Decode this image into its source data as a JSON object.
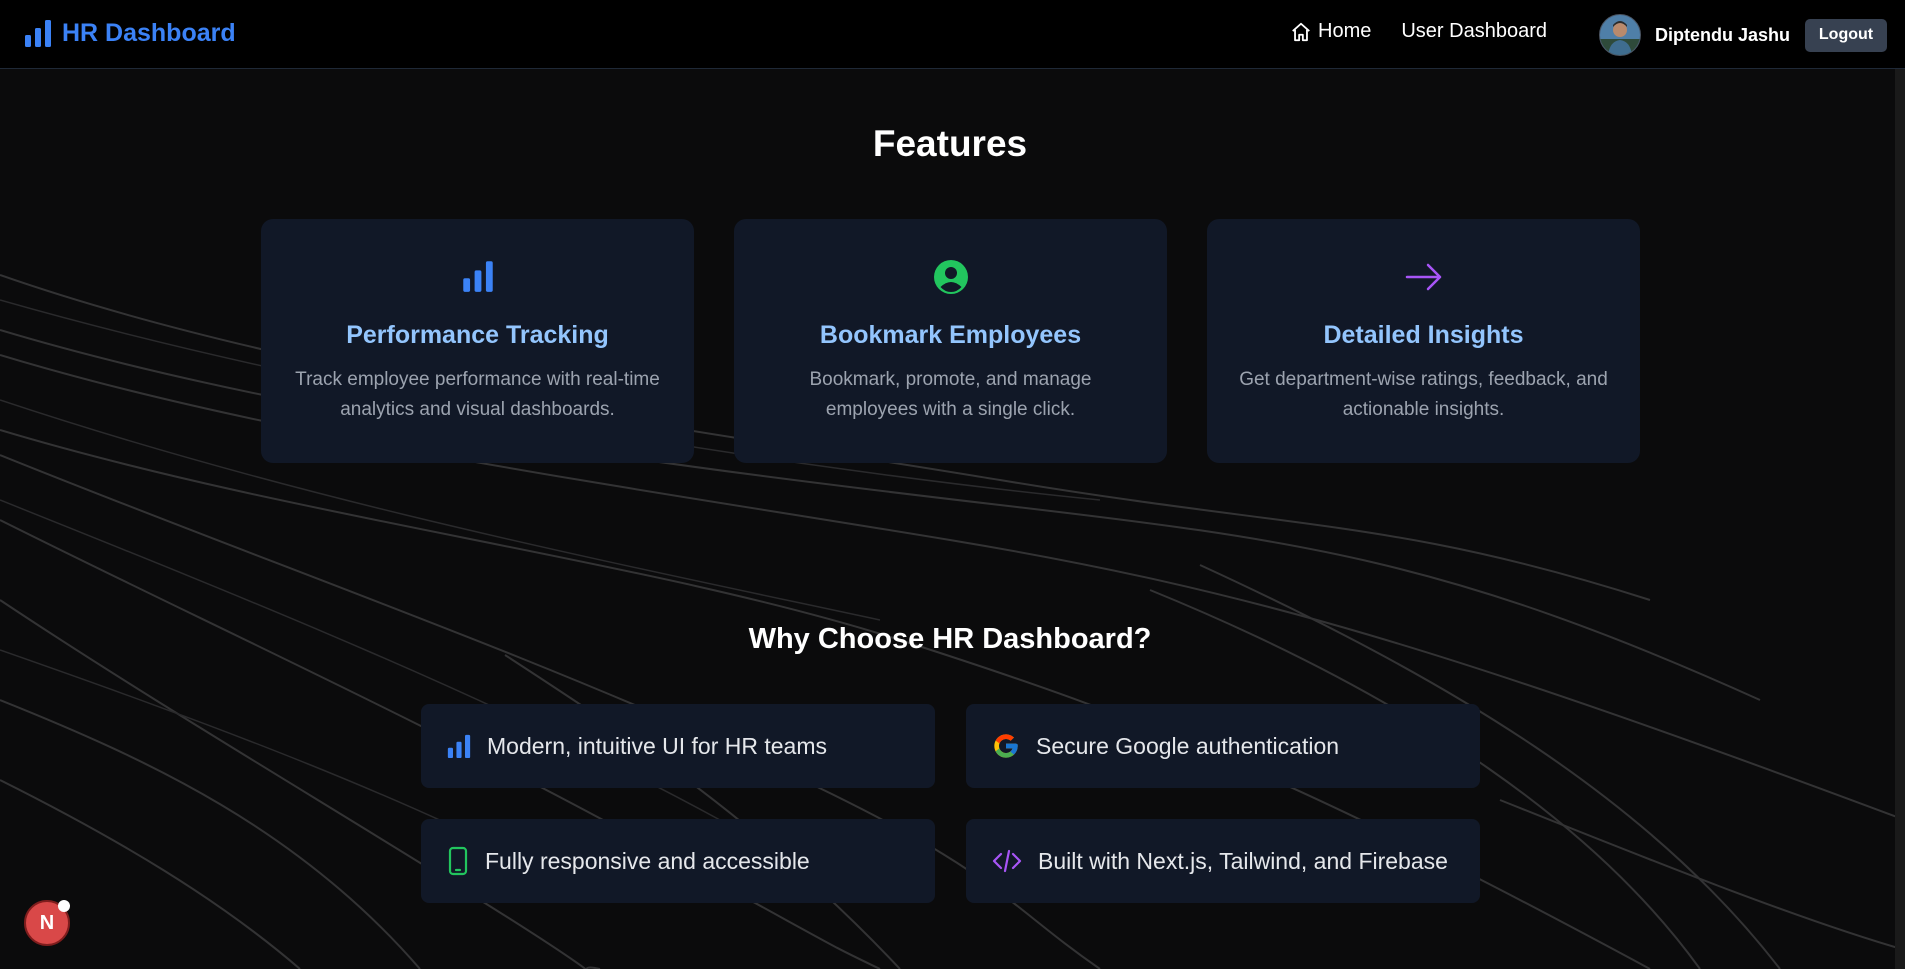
{
  "nav": {
    "brand": "HR Dashboard",
    "links": [
      {
        "label": "Home",
        "icon": "home-icon"
      },
      {
        "label": "User Dashboard"
      }
    ],
    "user_name": "Diptendu Jashu",
    "logout_label": "Logout"
  },
  "features": {
    "title": "Features",
    "cards": [
      {
        "icon": "bar-chart-icon",
        "icon_color": "#3b82f6",
        "title": "Performance Tracking",
        "description": "Track employee performance with real-time analytics and visual dashboards."
      },
      {
        "icon": "user-circle-icon",
        "icon_color": "#22c55e",
        "title": "Bookmark Employees",
        "description": "Bookmark, promote, and manage employees with a single click."
      },
      {
        "icon": "arrow-right-icon",
        "icon_color": "#a855f7",
        "title": "Detailed Insights",
        "description": "Get department-wise ratings, feedback, and actionable insights."
      }
    ]
  },
  "why": {
    "title": "Why Choose HR Dashboard?",
    "items": [
      {
        "icon": "bar-chart-icon",
        "text": "Modern, intuitive UI for HR teams"
      },
      {
        "icon": "google-icon",
        "text": "Secure Google authentication"
      },
      {
        "icon": "mobile-icon",
        "text": "Fully responsive and accessible"
      },
      {
        "icon": "code-icon",
        "text": "Built with Next.js, Tailwind, and Firebase"
      }
    ]
  },
  "dev_badge": "N",
  "colors": {
    "accent": "#3b82f6",
    "card_title": "#93c5fd",
    "green": "#22c55e",
    "purple": "#a855f7"
  }
}
